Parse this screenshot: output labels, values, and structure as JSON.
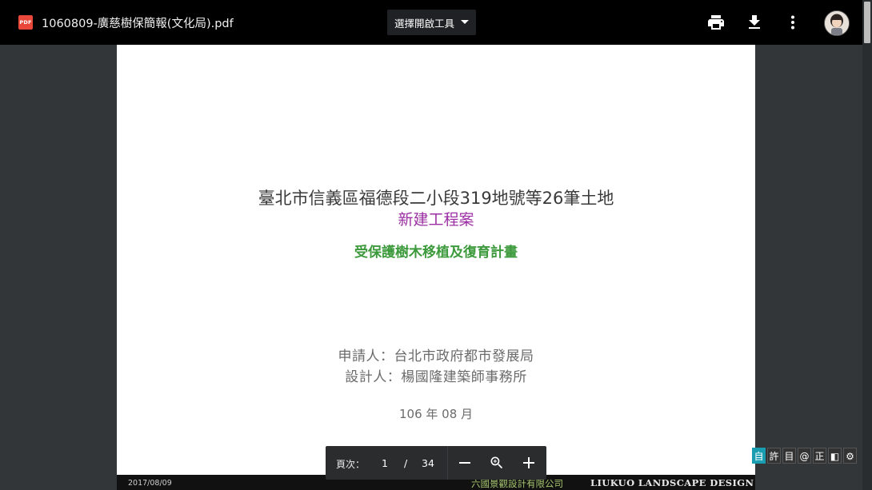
{
  "toolbar": {
    "file_icon_text": "PDF",
    "file_name": "1060809-廣慈樹保簡報(文化局).pdf",
    "open_with_label": "選擇開啟工具",
    "print_icon": "print-icon",
    "download_icon": "download-icon",
    "more_icon": "more-vert-icon",
    "avatar_icon": "user-avatar"
  },
  "document": {
    "title_line1": "臺北市信義區福德段二小段319地號等26筆土地",
    "title_line2": "新建工程案",
    "subtitle": "受保護樹木移植及復育計畫",
    "applicant": "申請人：台北市政府都市發展局",
    "designer": "設計人：楊國隆建築師事務所",
    "date": "106 年 08 月",
    "footer_date": "2017/08/09",
    "footer_company": "六國景觀設計有限公司",
    "footer_brand": "LIUKUO  LANDSCAPE DESIGN",
    "colors": {
      "title": "#3a3a3a",
      "title2": "#9b2fa3",
      "subtitle": "#3c9a3c"
    }
  },
  "pager": {
    "label": "頁次：",
    "current": "1",
    "separator": "/",
    "total": "34",
    "zoom_out_icon": "minus-icon",
    "zoom_fit_icon": "zoom-icon",
    "zoom_in_icon": "plus-icon"
  },
  "ime_bar": {
    "items": [
      "自",
      "許",
      "目",
      "@",
      "正",
      "◧",
      "⚙"
    ]
  }
}
